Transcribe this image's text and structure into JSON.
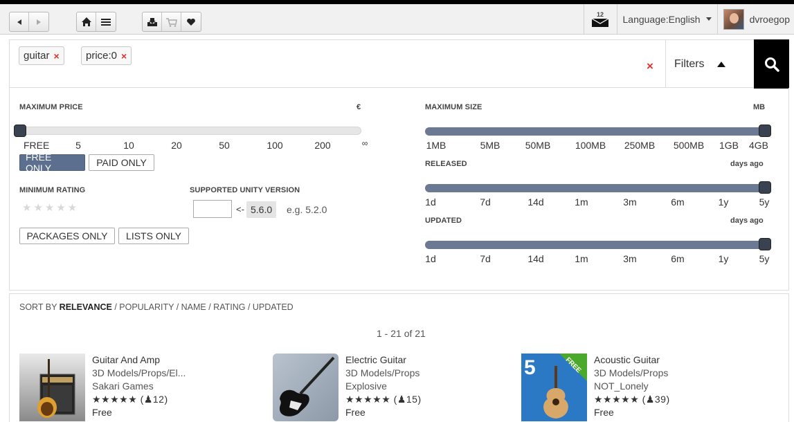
{
  "toolbar": {
    "mail_count": "12",
    "language": "Language:English",
    "username": "dvroegop"
  },
  "search": {
    "tags": [
      {
        "label": "guitar"
      },
      {
        "label": "price:0"
      }
    ],
    "tag_remove": "×",
    "clear": "×",
    "filters_label": "Filters"
  },
  "filters": {
    "max_price": {
      "label": "MAXIMUM PRICE",
      "unit": "€",
      "ticks": [
        "FREE",
        "5",
        "10",
        "20",
        "50",
        "100",
        "200",
        "∞"
      ],
      "level": 0
    },
    "price_buttons": {
      "free": "FREE ONLY",
      "paid": "PAID ONLY"
    },
    "min_rating": {
      "label": "MINIMUM RATING",
      "stars": "★★★★★",
      "value": 0
    },
    "unity_version": {
      "label": "SUPPORTED UNITY VERSION",
      "arrow": "<-",
      "current": "5.6.0",
      "hint": "e.g. 5.2.0",
      "value": ""
    },
    "type_buttons": {
      "packages": "PACKAGES ONLY",
      "lists": "LISTS ONLY"
    },
    "max_size": {
      "label": "MAXIMUM SIZE",
      "unit": "MB",
      "ticks": [
        "1MB",
        "5MB",
        "50MB",
        "100MB",
        "250MB",
        "500MB",
        "1GB",
        "4GB"
      ],
      "level": 1
    },
    "released": {
      "label": "RELEASED",
      "unit": "days ago",
      "ticks": [
        "1d",
        "7d",
        "14d",
        "1m",
        "3m",
        "6m",
        "1y",
        "5y"
      ],
      "level": 1
    },
    "updated": {
      "label": "UPDATED",
      "unit": "days ago",
      "ticks": [
        "1d",
        "7d",
        "14d",
        "1m",
        "3m",
        "6m",
        "1y",
        "5y"
      ],
      "level": 1
    }
  },
  "results": {
    "sort_prefix": "SORT BY ",
    "sort_active": "RELEVANCE",
    "sort_rest": " / POPULARITY / NAME / RATING / UPDATED",
    "count": "1 - 21 of 21",
    "items": [
      {
        "name": "Guitar And Amp",
        "category": "3D Models/Props/El...",
        "publisher": "Sakari Games",
        "stars": "★★★★★",
        "reviews": "(♟12)",
        "price": "Free"
      },
      {
        "name": "Electric Guitar",
        "category": "3D Models/Props",
        "publisher": "Explosive",
        "stars": "★★★★★",
        "reviews": "(♟15)",
        "price": "Free"
      },
      {
        "name": "Acoustic Guitar",
        "category": "3D Models/Props",
        "publisher": "NOT_Lonely",
        "stars": "★★★★★",
        "reviews": "(♟39)",
        "price": "Free",
        "badge": "FREE",
        "logo_number": "5"
      }
    ]
  }
}
